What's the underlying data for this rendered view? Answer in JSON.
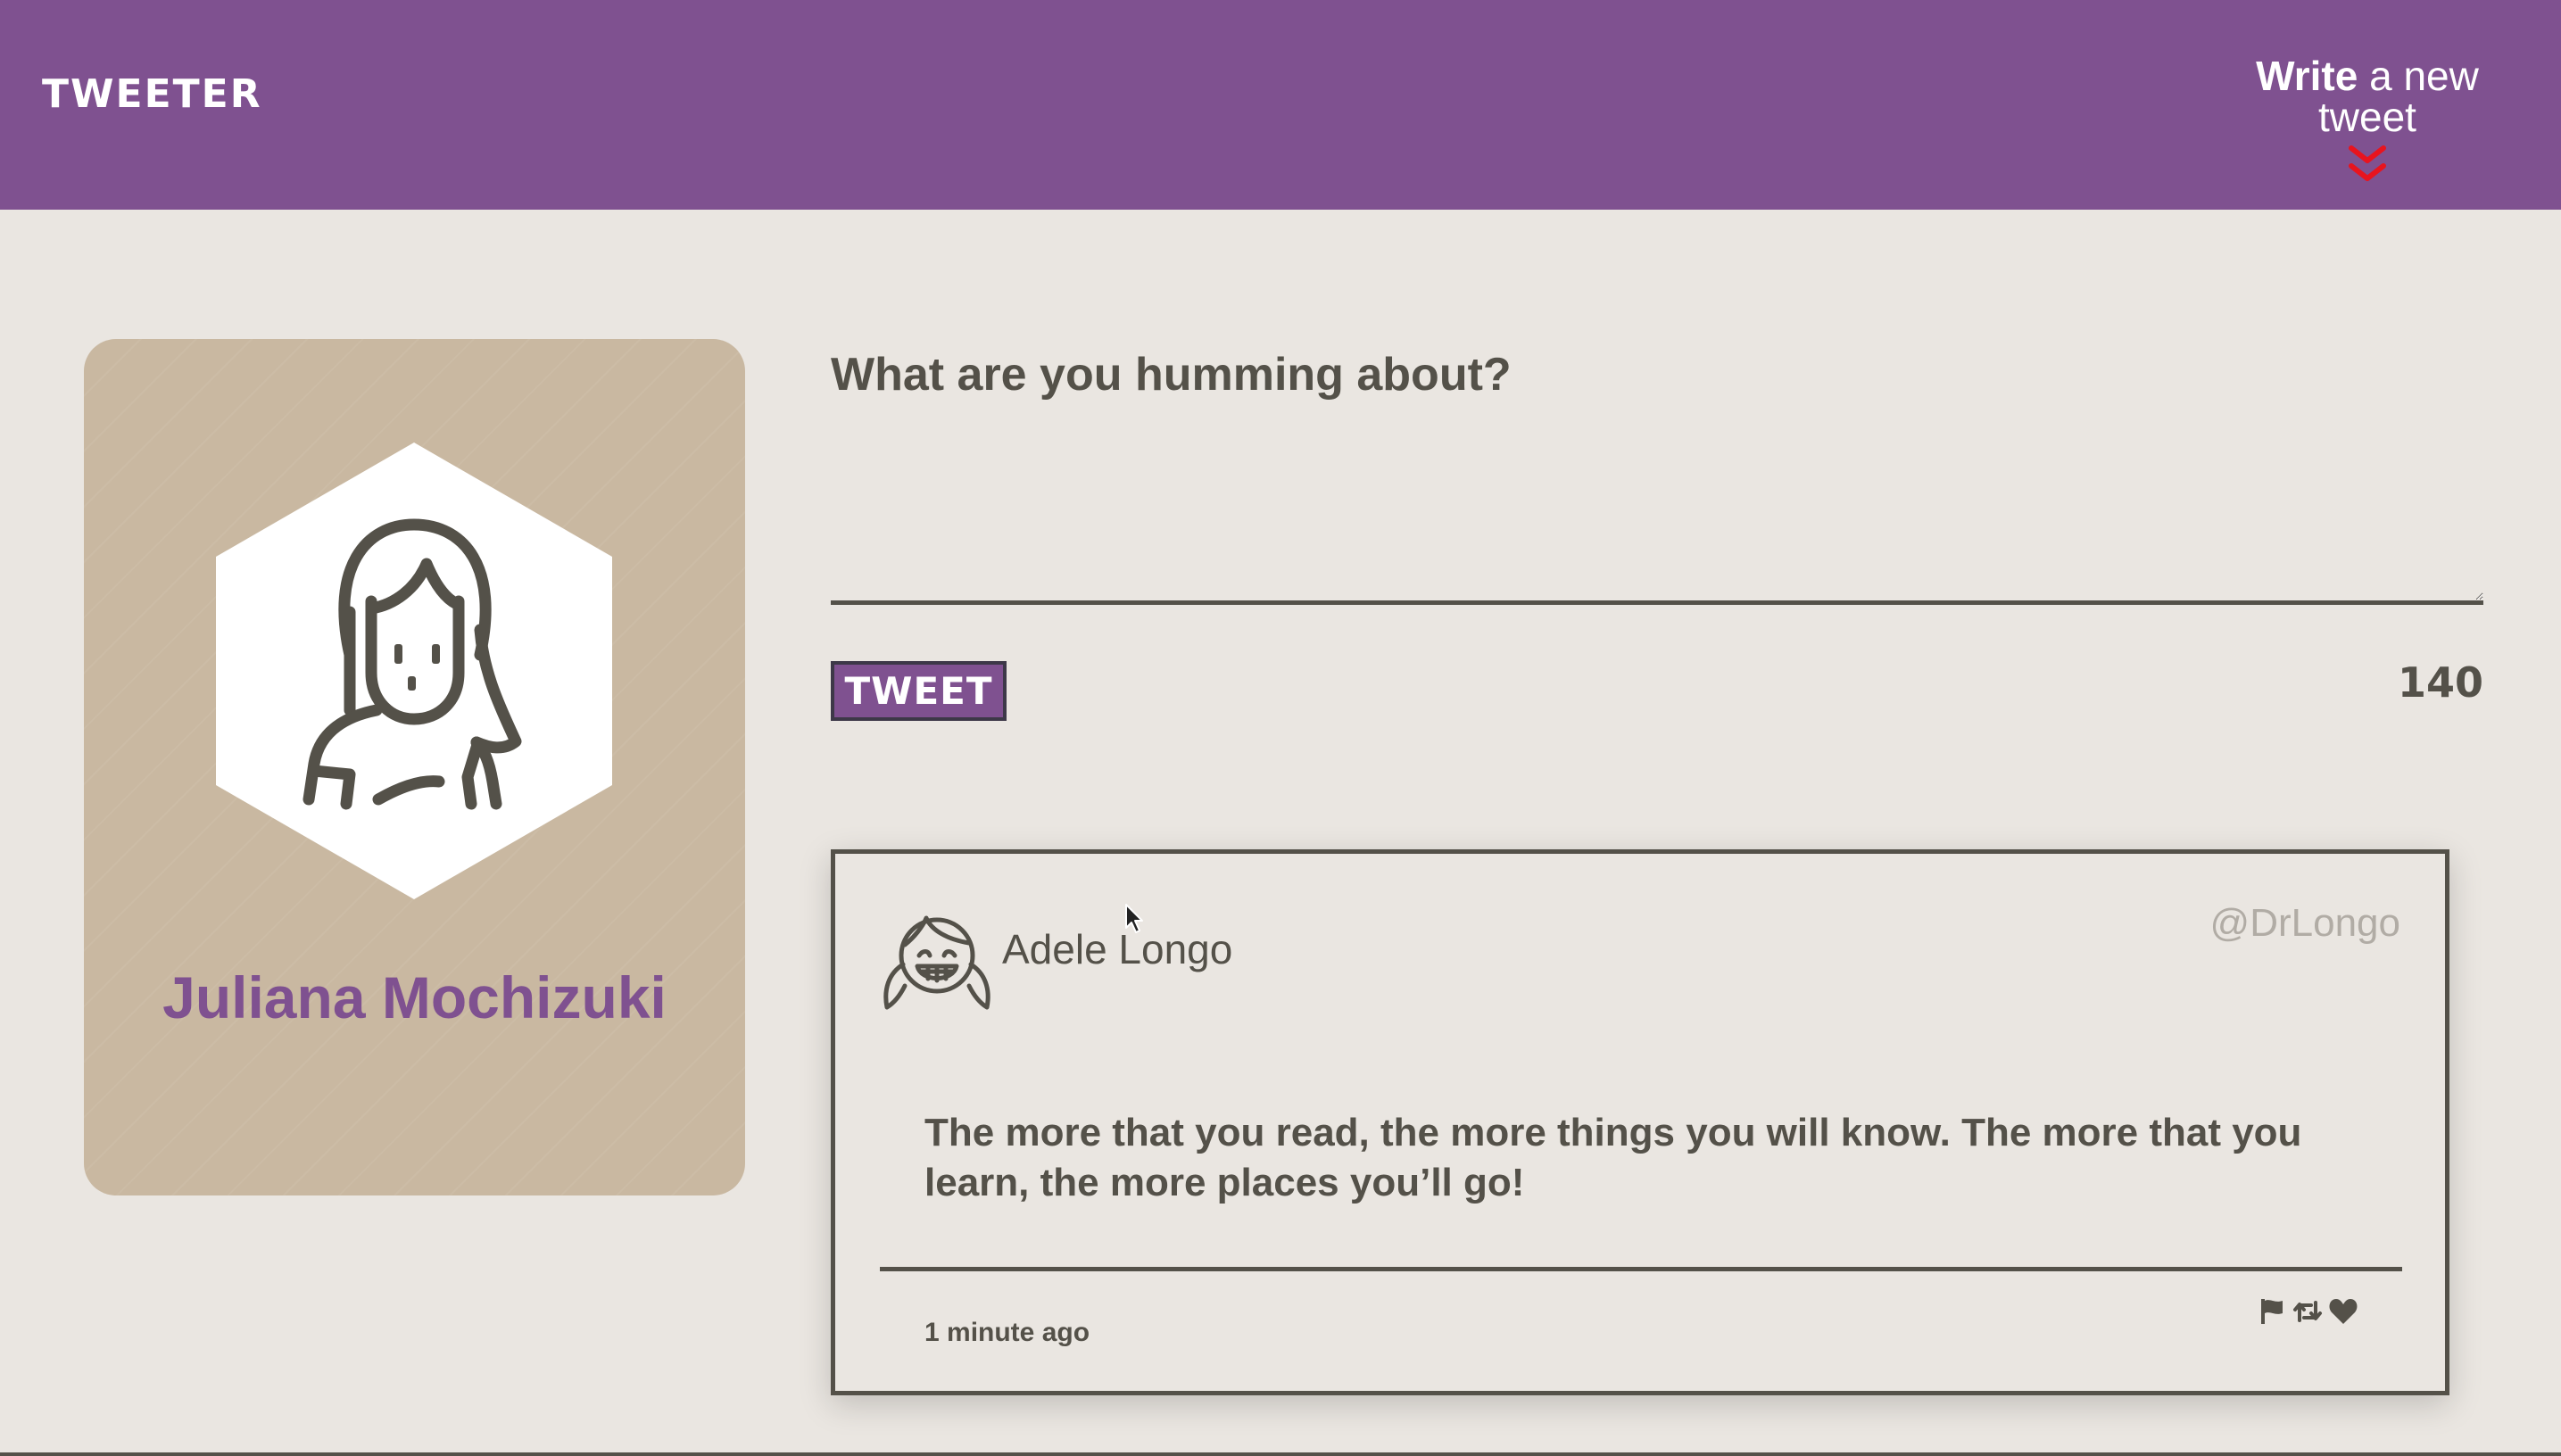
{
  "nav": {
    "brand": "Tweeter",
    "compose_toggle_bold": "Write",
    "compose_toggle_rest": " a new tweet",
    "toggle_icon": "double-chevron-down-icon"
  },
  "profile": {
    "name": "Juliana Mochizuki",
    "avatar_icon": "woman-avatar-icon"
  },
  "composer": {
    "placeholder": "What are you humming about?",
    "value": "",
    "submit_label": "Tweet",
    "char_counter": "140"
  },
  "tweets": [
    {
      "avatar_icon": "girl-avatar-icon",
      "name": "Adele Longo",
      "handle": "@DrLongo",
      "content": "The more that you read, the more things you will know. The more that you learn, the more places you’ll go!",
      "timestamp": "1 minute ago",
      "actions": [
        "flag-icon",
        "retweet-icon",
        "heart-icon"
      ]
    }
  ],
  "colors": {
    "nav_background": "#7f5190",
    "page_background": "#eae6e1",
    "profile_card": "#c9b8a1",
    "text": "#545149",
    "accent": "#7f5190",
    "handle": "#b1aca5",
    "toggle_icon": "#e8141e"
  }
}
